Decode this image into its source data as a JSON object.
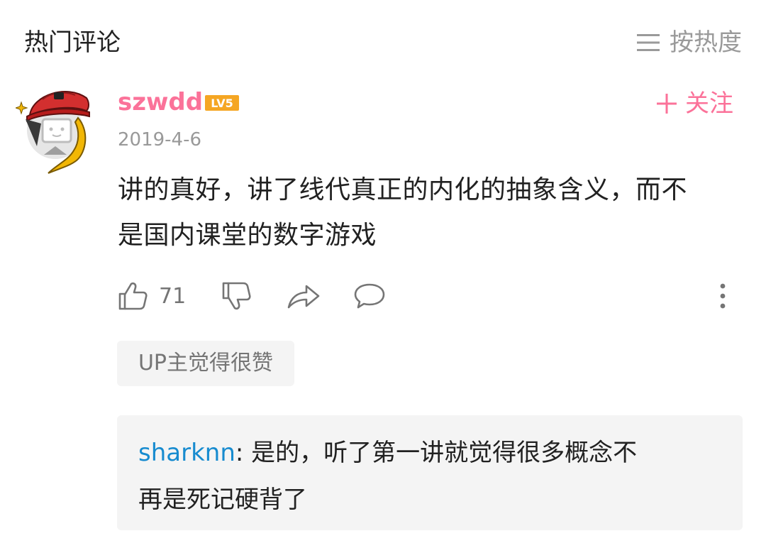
{
  "header": {
    "title": "热门评论",
    "sort_icon": "list-icon",
    "sort_label": "按热度"
  },
  "comment": {
    "avatar": "avatar-red-cap-icon",
    "username": "szwdd",
    "level": "LV5",
    "follow_icon": "plus-icon",
    "follow_label": "关注",
    "date": "2019-4-6",
    "text_line1": "讲的真好，讲了线代真正的内化的抽象含义，而不",
    "text_line2": "是国内课堂的数字游戏",
    "actions": {
      "like_icon": "thumbs-up-icon",
      "like_count": "71",
      "dislike_icon": "thumbs-down-icon",
      "share_icon": "share-icon",
      "reply_icon": "comment-bubble-icon",
      "more_icon": "more-vertical-icon"
    },
    "up_badge": "UP主觉得很赞",
    "reply": {
      "user": "sharknn",
      "separator": ": ",
      "text_line1": "是的，听了第一讲就觉得很多概念不",
      "text_line2": "再是死记硬背了"
    }
  },
  "colors": {
    "accent_pink": "#fb7299",
    "reply_user_blue": "#178bcf",
    "muted_gray": "#999999",
    "panel_bg": "#f4f4f4",
    "level_badge_orange": "#f5a623"
  }
}
